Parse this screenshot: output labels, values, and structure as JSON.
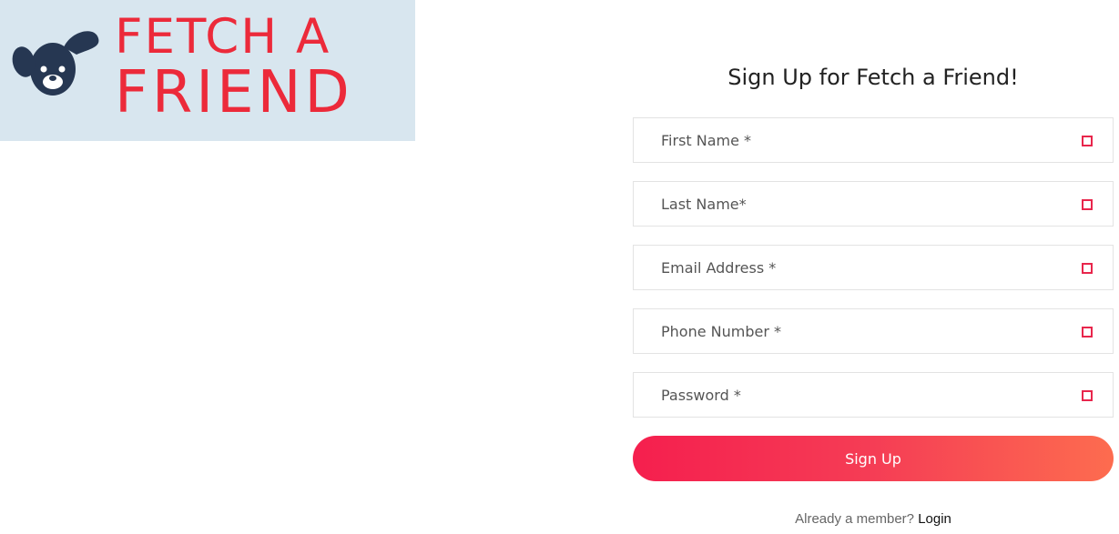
{
  "logo": {
    "line1": "FETCH A",
    "line2": "FRIEND",
    "icon": "dog-icon",
    "brand_color": "#ec2a3a",
    "bg_color": "#d8e6ef"
  },
  "form": {
    "title": "Sign Up for Fetch a Friend!",
    "fields": [
      {
        "placeholder": "First Name *"
      },
      {
        "placeholder": "Last Name*"
      },
      {
        "placeholder": "Email Address *"
      },
      {
        "placeholder": "Phone Number *"
      },
      {
        "placeholder": "Password *"
      }
    ],
    "submit_label": "Sign Up",
    "accent_gradient": [
      "#f51f4e",
      "#fd6c4f"
    ]
  },
  "footer": {
    "prompt": "Already a member?",
    "login_label": "Login"
  }
}
